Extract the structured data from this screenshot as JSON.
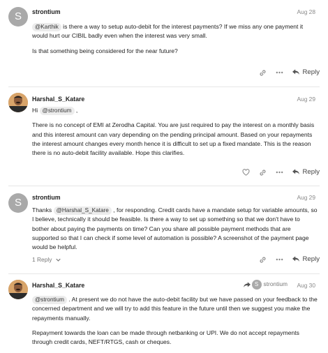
{
  "posts": [
    {
      "username": "strontium",
      "avatar_letter": "S",
      "date": "Aug 28",
      "mention": "@Karthik",
      "para1": " is there a way to setup auto-debit for the interest payments? If we miss any one payment it would hurt our CIBIL badly even when the interest was very small.",
      "para2": "Is that something being considered for the near future?",
      "reply_label": "Reply"
    },
    {
      "username": "Harshal_S_Katare",
      "date": "Aug 29",
      "greeting": "Hi ",
      "mention": "@strontium",
      "greeting_end": " ,",
      "para1": "There is no concept of EMI at Zerodha Capital. You are just required to pay the interest on a monthly basis and this interest amount can vary depending on the pending principal amount. Based on your repayments the interest amount changes every month hence it is difficult to set up a fixed mandate. This is the reason there is no auto-debit facility available. Hope this clarifies.",
      "reply_label": "Reply"
    },
    {
      "username": "strontium",
      "avatar_letter": "S",
      "date": "Aug 29",
      "lead": "Thanks ",
      "mention": "@Harshal_S_Katare",
      "para1": " , for responding. Credit cards have a mandate setup for variable amounts, so I believe, technically it should be feasible. Is there a way to set up something so that we don't have to bother about paying the payments on time? Can you share all possible payment methods that are supported so that I can check if some level of automation is possible? A screenshot of the payment page would be helpful.",
      "replies_label": "1 Reply",
      "reply_label": "Reply"
    },
    {
      "username": "Harshal_S_Katare",
      "date": "Aug 30",
      "reply_to_user": "strontium",
      "reply_to_letter": "S",
      "mention": "@strontium",
      "para1": " . At present we do not have the auto-debit facility but we have passed on your feedback to the concerned department and we will try to add this feature in the future until then we suggest you make the repayments manually.",
      "para2": "Repayment towards the loan can be made through netbanking or UPI. We do not accept repayments through credit cards, NEFT/RTGS, cash or cheques."
    }
  ]
}
